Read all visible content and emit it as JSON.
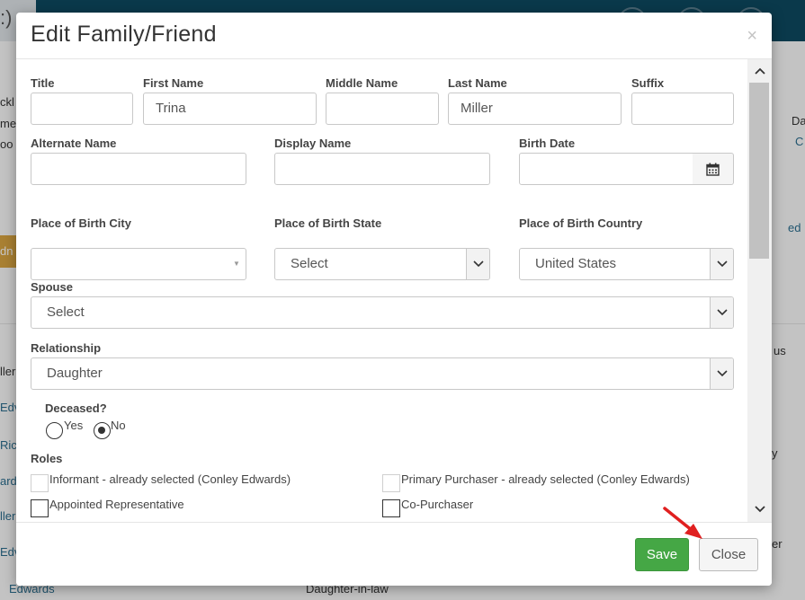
{
  "background": {
    "left_fragment": ":)",
    "left_texts": [
      "ckl",
      "me",
      "oo",
      "dn",
      "ller",
      "Edv",
      "Rich",
      "ard",
      "ller",
      "Edv",
      "Edwards"
    ],
    "right_texts": [
      "Da",
      "C",
      "ed",
      "us",
      "y",
      "er"
    ],
    "bottom_relationship": "Daughter-in-law"
  },
  "modal": {
    "title": "Edit Family/Friend",
    "close_x": "×",
    "fields": {
      "title": {
        "label": "Title",
        "value": ""
      },
      "first_name": {
        "label": "First Name",
        "value": "Trina"
      },
      "middle_name": {
        "label": "Middle Name",
        "value": ""
      },
      "last_name": {
        "label": "Last Name",
        "value": "Miller"
      },
      "suffix": {
        "label": "Suffix",
        "value": ""
      },
      "alternate_name": {
        "label": "Alternate Name",
        "value": ""
      },
      "display_name": {
        "label": "Display Name",
        "value": ""
      },
      "birth_date": {
        "label": "Birth Date",
        "value": ""
      },
      "pob_city": {
        "label": "Place of Birth City",
        "value": ""
      },
      "pob_state": {
        "label": "Place of Birth State",
        "value": "Select"
      },
      "pob_country": {
        "label": "Place of Birth Country",
        "value": "United States"
      },
      "spouse": {
        "label": "Spouse",
        "value": "Select"
      },
      "relationship": {
        "label": "Relationship",
        "value": "Daughter"
      }
    },
    "deceased": {
      "label": "Deceased?",
      "options": [
        {
          "label": "Yes",
          "selected": false
        },
        {
          "label": "No",
          "selected": true
        }
      ]
    },
    "roles": {
      "label": "Roles",
      "items": [
        {
          "label": "Informant - already selected (Conley Edwards)",
          "checked": false,
          "disabled": true
        },
        {
          "label": "Primary Purchaser - already selected (Conley Edwards)",
          "checked": false,
          "disabled": true
        },
        {
          "label": "Appointed Representative",
          "checked": false,
          "disabled": false
        },
        {
          "label": "Co-Purchaser",
          "checked": false,
          "disabled": false
        }
      ]
    },
    "footer": {
      "save_label": "Save",
      "close_label": "Close"
    }
  },
  "colors": {
    "save": "#45a745",
    "header_bar": "#0e4a60",
    "annotation_arrow": "#e02020"
  }
}
